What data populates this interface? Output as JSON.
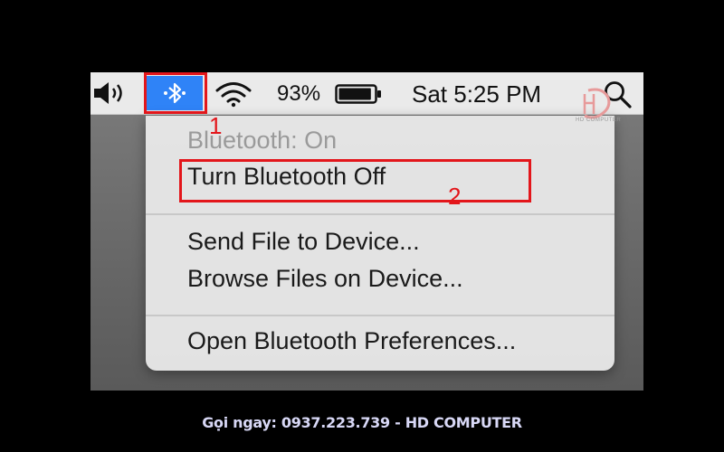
{
  "menubar": {
    "icons": [
      "volume-icon",
      "bluetooth-icon",
      "wifi-icon",
      "battery-icon",
      "search-icon"
    ],
    "battery_percent": "93%",
    "battery_level": 0.93,
    "clock": "Sat 5:25 PM",
    "bluetooth_active_color": "#2f83f7"
  },
  "bluetooth_menu": {
    "status": "Bluetooth: On",
    "turn_off": "Turn Bluetooth Off",
    "send_file": "Send File to Device...",
    "browse_files": "Browse Files on Device...",
    "preferences": "Open Bluetooth Preferences..."
  },
  "annotations": {
    "step1": "1",
    "step2": "2",
    "highlight_color": "#e3161b"
  },
  "watermark": {
    "logo": "HD",
    "text": "HD COMPUTER"
  },
  "footer": {
    "text": "Gọi ngay: 0937.223.739 - HD COMPUTER"
  }
}
